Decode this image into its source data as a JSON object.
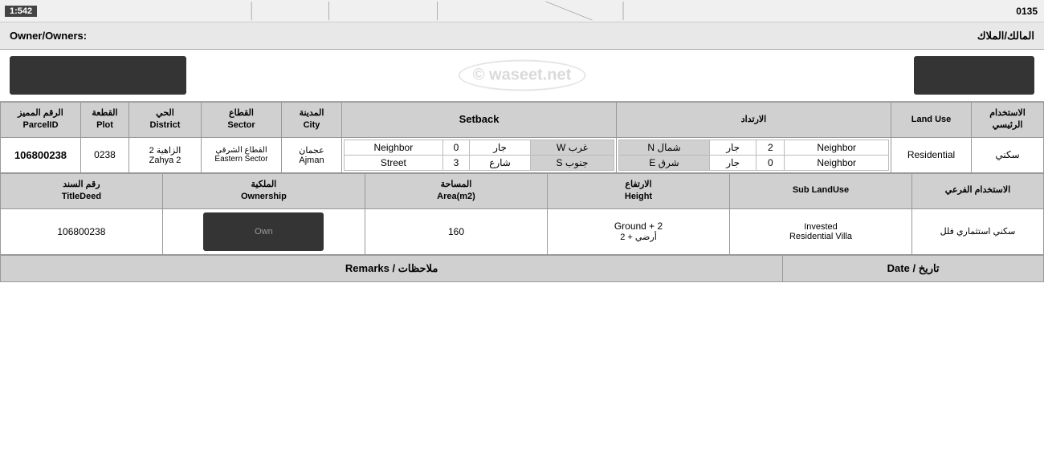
{
  "topBar": {
    "scale": "1:542",
    "cornerNumber": "0135"
  },
  "ownerSection": {
    "labelLeft": "Owner/Owners:",
    "labelRight": "المالك/الملاك"
  },
  "headers1": {
    "parcelID": {
      "arabic": "الرقم المميز",
      "english": "ParcelID"
    },
    "plot": {
      "arabic": "القطعة",
      "english": "Plot"
    },
    "district": {
      "arabic": "الحي",
      "english": "District"
    },
    "sector": {
      "arabic": "القطاع",
      "english": "Sector"
    },
    "city": {
      "arabic": "المدينة",
      "english": "City"
    },
    "setback": {
      "arabic": "",
      "english": "Setback"
    },
    "irtidad": {
      "arabic": "الارتداد",
      "english": ""
    },
    "landuse": {
      "arabic": "",
      "english": "Land Use"
    },
    "mainUse": {
      "arabic": "الاستخدام الرئيسي",
      "english": ""
    }
  },
  "dataRow1": {
    "parcelID": "106800238",
    "plot": "0238",
    "district": {
      "arabic": "الزاهية 2",
      "english": "Zahya 2"
    },
    "sector": {
      "arabic": "القطاع الشرقي",
      "english": "Eastern Sector"
    },
    "city": {
      "arabic": "عجمان",
      "english": "Ajman"
    },
    "setback": {
      "row1": {
        "label": "Neighbor",
        "value": "0",
        "arabic": "جار",
        "dir": "W غرب"
      },
      "row2": {
        "label": "Street",
        "value": "3",
        "arabic": "شارع",
        "dir": "S جنوب"
      }
    },
    "irtidad": {
      "row1": {
        "label": "Neighbor",
        "value": "2",
        "arabic": "جار",
        "dir": "N شمال"
      },
      "row2": {
        "label": "Neighbor",
        "value": "0",
        "arabic": "جار",
        "dir": "E شرق"
      }
    },
    "landuse": "Residential",
    "mainUse": "سكني"
  },
  "headers2": {
    "titleDeed": {
      "arabic": "رقم السند",
      "english": "TitleDeed"
    },
    "ownership": {
      "arabic": "الملكية",
      "english": "Ownership"
    },
    "area": {
      "arabic": "المساحة",
      "english": "Area(m2)"
    },
    "height": {
      "arabic": "الارتفاع",
      "english": "Height"
    },
    "subLandUse": {
      "arabic": "",
      "english": "Sub LandUse"
    },
    "subUseArabic": {
      "arabic": "الاستخدام الفرعي",
      "english": ""
    }
  },
  "dataRow2": {
    "titleDeed": "106800238",
    "ownership": "Own",
    "area": "160",
    "height": {
      "english": "Ground + 2",
      "arabic": "أرضي + 2"
    },
    "subLandUse": {
      "line1": "Invested",
      "line2": "Residential Villa"
    },
    "subUseArabic": "سكني استثماري فلل"
  },
  "footer": {
    "remarks": "Remarks / ملاحظات",
    "date": "Date / تاريخ"
  }
}
